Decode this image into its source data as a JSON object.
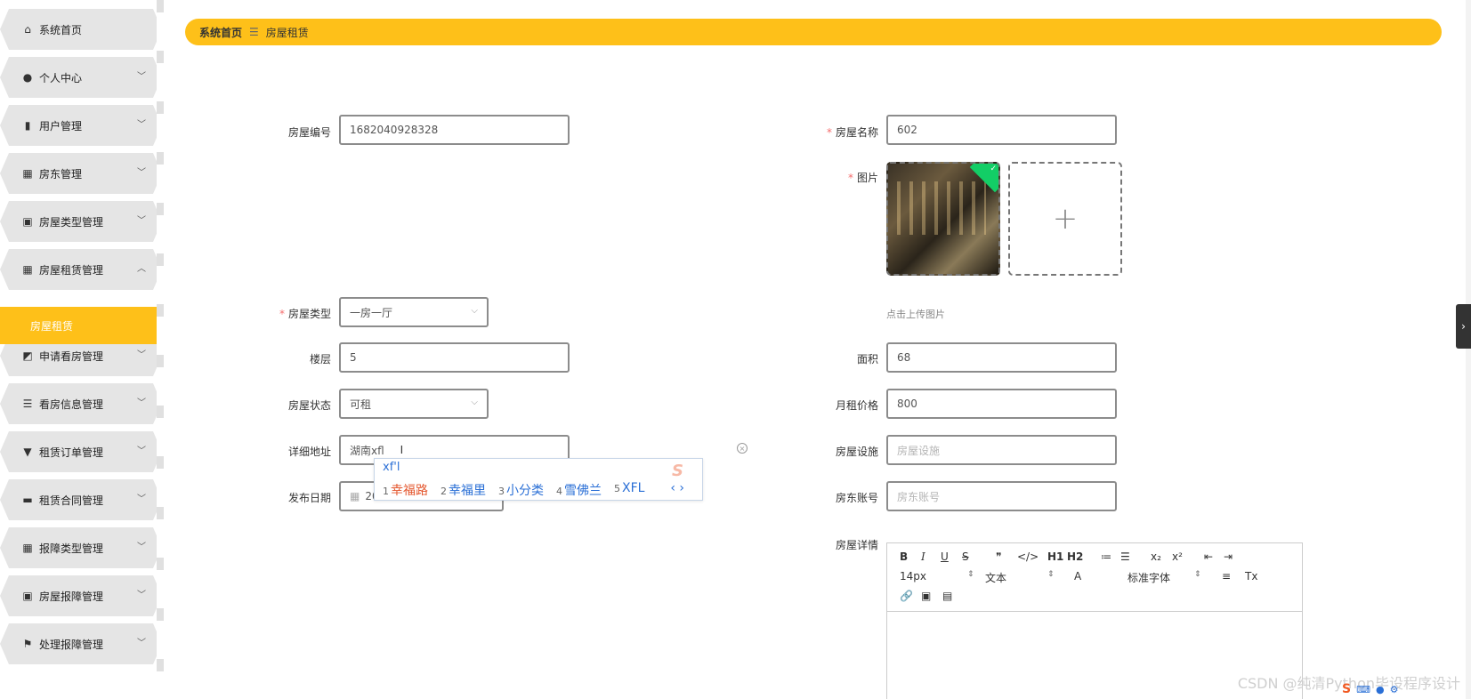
{
  "sidebar": {
    "items": [
      {
        "label": "系统首页",
        "icon": "home-icon",
        "glyph": "⌂"
      },
      {
        "label": "个人中心",
        "icon": "person-icon",
        "glyph": "●"
      },
      {
        "label": "用户管理",
        "icon": "bar-chart-icon",
        "glyph": "▮"
      },
      {
        "label": "房东管理",
        "icon": "grid-icon",
        "glyph": "▦"
      },
      {
        "label": "房屋类型管理",
        "icon": "clipboard-icon",
        "glyph": "▣"
      },
      {
        "label": "房屋租赁管理",
        "icon": "apps-icon",
        "glyph": "▦"
      },
      {
        "label": "申请看房管理",
        "icon": "line-chart-icon",
        "glyph": "◩"
      },
      {
        "label": "看房信息管理",
        "icon": "list-icon",
        "glyph": "☰"
      },
      {
        "label": "租赁订单管理",
        "icon": "stamp-icon",
        "glyph": "▼"
      },
      {
        "label": "租赁合同管理",
        "icon": "wallet-icon",
        "glyph": "▬"
      },
      {
        "label": "报障类型管理",
        "icon": "grid-icon",
        "glyph": "▦"
      },
      {
        "label": "房屋报障管理",
        "icon": "clipboard-check-icon",
        "glyph": "▣"
      },
      {
        "label": "处理报障管理",
        "icon": "flag-icon",
        "glyph": "⚑"
      }
    ],
    "active_sub": "房屋租赁"
  },
  "breadcrumb": {
    "home": "系统首页",
    "sep": "☰",
    "current": "房屋租赁"
  },
  "form": {
    "house_no": {
      "label": "房屋编号",
      "value": "1682040928328"
    },
    "house_name": {
      "label": "房屋名称",
      "value": "602"
    },
    "image": {
      "label": "图片",
      "hint": "点击上传图片"
    },
    "house_type": {
      "label": "房屋类型",
      "value": "一房一厅"
    },
    "floor": {
      "label": "楼层",
      "value": "5"
    },
    "area": {
      "label": "面积",
      "value": "68"
    },
    "house_status": {
      "label": "房屋状态",
      "value": "可租"
    },
    "monthly_rent": {
      "label": "月租价格",
      "value": "800"
    },
    "address": {
      "label": "详细地址",
      "value": "湖南xfl"
    },
    "facilities": {
      "label": "房屋设施",
      "placeholder": "房屋设施"
    },
    "publish_date": {
      "label": "发布日期",
      "value": "2023-04-21"
    },
    "landlord_account": {
      "label": "房东账号",
      "placeholder": "房东账号"
    },
    "details": {
      "label": "房屋详情"
    }
  },
  "ime": {
    "composition": "xf'l",
    "candidates": [
      {
        "n": "1",
        "text": "幸福路"
      },
      {
        "n": "2",
        "text": "幸福里"
      },
      {
        "n": "3",
        "text": "小分类"
      },
      {
        "n": "4",
        "text": "雪佛兰"
      },
      {
        "n": "5",
        "text": "XFL"
      }
    ],
    "nav": "‹ ›",
    "logo": "S"
  },
  "editor": {
    "row1": [
      "B",
      "I",
      "U",
      "S",
      "❞",
      "</>",
      "H1",
      "H2",
      "≔",
      "☰",
      "x₂",
      "x²",
      "⇤",
      "⇥"
    ],
    "font_size": "14px",
    "text_type": "文本",
    "font_family": "标准字体",
    "color_a": "A",
    "align": "≡",
    "clear": "Tx",
    "row3": [
      "🔗",
      "▣",
      "▤"
    ]
  },
  "watermark": "CSDN @纯清Python毕设程序设计",
  "right_tab": "›"
}
